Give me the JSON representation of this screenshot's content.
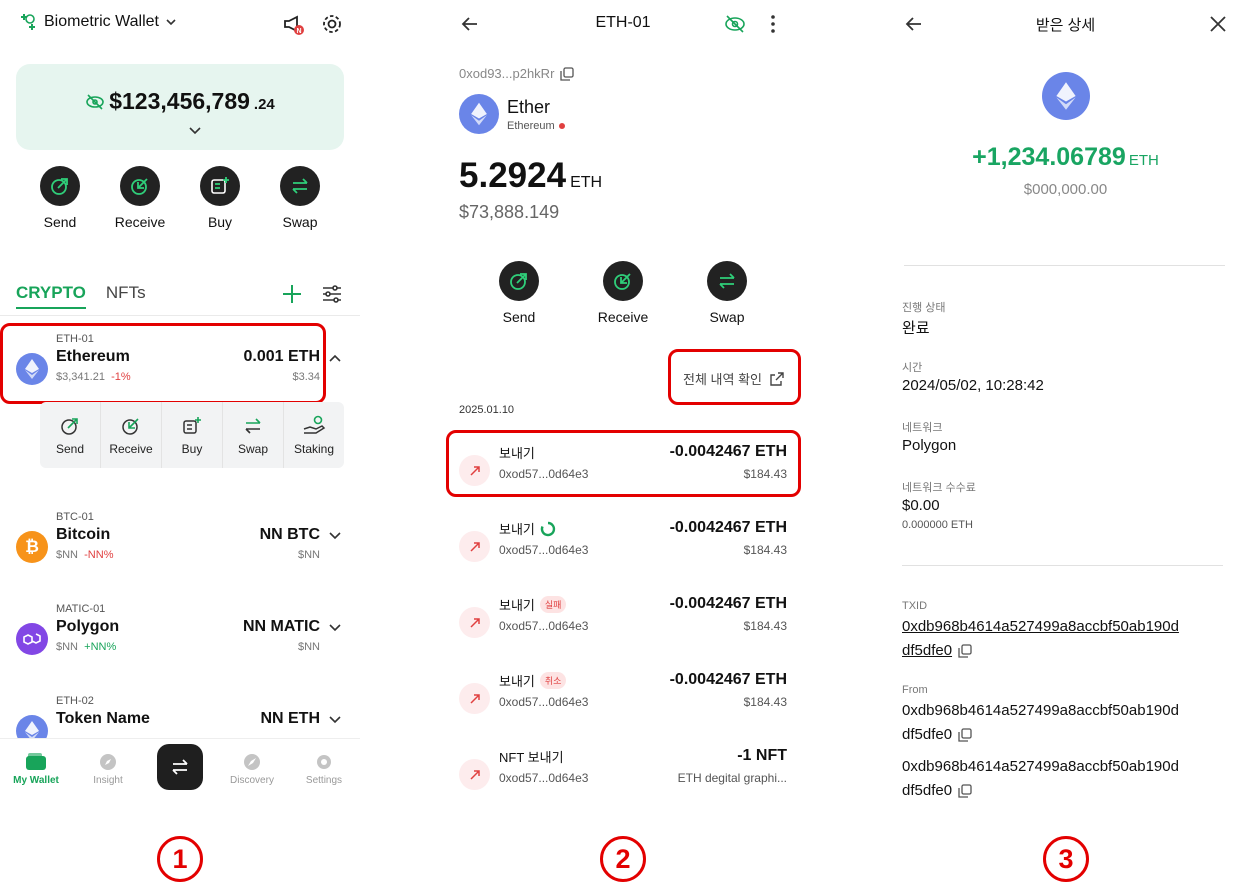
{
  "panel1": {
    "wallet_name": "Biometric Wallet",
    "balance_main": "$123,456,789",
    "balance_cents": ".24",
    "actions": [
      {
        "label": "Send"
      },
      {
        "label": "Receive"
      },
      {
        "label": "Buy"
      },
      {
        "label": "Swap"
      }
    ],
    "tabs": {
      "crypto": "CRYPTO",
      "nfts": "NFTs"
    },
    "assets": [
      {
        "account": "ETH-01",
        "name": "Ethereum",
        "price": "$3,341.21",
        "change": "-1%",
        "amount": "0.001 ETH",
        "fiat": "$3.34"
      },
      {
        "account": "BTC-01",
        "name": "Bitcoin",
        "price": "$NN",
        "change": "-NN%",
        "amount": "NN BTC",
        "fiat": "$NN"
      },
      {
        "account": "MATIC-01",
        "name": "Polygon",
        "price": "$NN",
        "change": "+NN%",
        "amount": "NN MATIC",
        "fiat": "$NN"
      },
      {
        "account": "ETH-02",
        "name": "Token Name",
        "amount": "NN ETH"
      }
    ],
    "sub_actions": [
      {
        "label": "Send"
      },
      {
        "label": "Receive"
      },
      {
        "label": "Buy"
      },
      {
        "label": "Swap"
      },
      {
        "label": "Staking"
      }
    ],
    "nav": {
      "wallet": "My Wallet",
      "insight": "Insight",
      "discovery": "Discovery",
      "settings": "Settings"
    },
    "step": "1"
  },
  "panel2": {
    "title": "ETH-01",
    "address": "0xod93...p2hkRr",
    "coin_name": "Ether",
    "network": "Ethereum",
    "balance": "5.2924",
    "balance_unit": "ETH",
    "fiat": "$73,888.149",
    "actions": [
      {
        "label": "Send"
      },
      {
        "label": "Receive"
      },
      {
        "label": "Swap"
      }
    ],
    "history_link": "전체 내역 확인",
    "date": "2025.01.10",
    "txs": [
      {
        "label": "보내기",
        "from": "0xod57...0d64e3",
        "value": "-0.0042467 ETH",
        "fiat": "$184.43"
      },
      {
        "label": "보내기",
        "from": "0xod57...0d64e3",
        "value": "-0.0042467 ETH",
        "fiat": "$184.43"
      },
      {
        "label": "보내기",
        "badge": "실패",
        "from": "0xod57...0d64e3",
        "value": "-0.0042467 ETH",
        "fiat": "$184.43"
      },
      {
        "label": "보내기",
        "badge": "취소",
        "from": "0xod57...0d64e3",
        "value": "-0.0042467 ETH",
        "fiat": "$184.43"
      },
      {
        "label": "NFT 보내기",
        "from": "0xod57...0d64e3",
        "value": "-1 NFT",
        "fiat": "ETH degital graphi..."
      }
    ],
    "step": "2"
  },
  "panel3": {
    "title": "받은 상세",
    "amount": "+1,234.06789",
    "unit": "ETH",
    "fiat": "$000,000.00",
    "status_label": "진행 상태",
    "status_value": "완료",
    "time_label": "시간",
    "time_value": "2024/05/02, 10:28:42",
    "network_label": "네트워크",
    "network_value": "Polygon",
    "fee_label": "네트워크 수수료",
    "fee_value": "$0.00",
    "fee_eth": "0.000000 ETH",
    "txid_label": "TXID",
    "txid_line1": "0xdb968b4614a527499a8accbf50ab190d",
    "txid_line2": "df5dfe0",
    "from_label": "From",
    "from_line1": "0xdb968b4614a527499a8accbf50ab190d",
    "from_line2": "df5dfe0",
    "to_line1": "0xdb968b4614a527499a8accbf50ab190d",
    "to_line2": "df5dfe0",
    "step": "3"
  },
  "colors": {
    "accent_green": "#18a45a",
    "highlight_red": "#e30000",
    "eth_blue": "#6a85e8",
    "btc_orange": "#f7931a",
    "polygon_purple": "#8247e5"
  }
}
